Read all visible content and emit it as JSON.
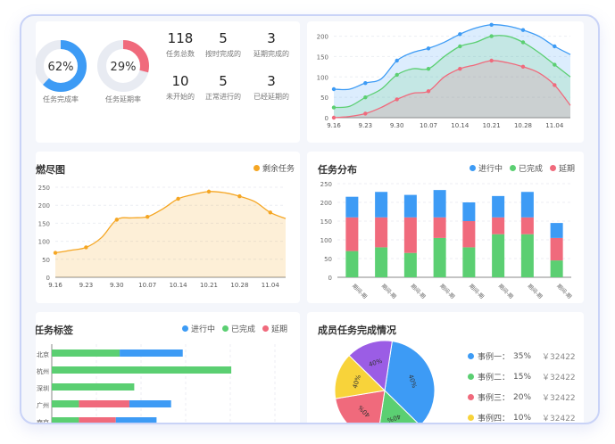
{
  "colors": {
    "blue": "#3d9bf5",
    "green": "#5bcf72",
    "red": "#f06a7c",
    "orange": "#f5a623",
    "purple": "#9b5de5",
    "yellow": "#f8d33a"
  },
  "overview": {
    "donuts": [
      {
        "value": "62%",
        "label": "任务完成率",
        "fraction": 0.62,
        "color": "#3d9bf5"
      },
      {
        "value": "29%",
        "label": "任务延期率",
        "fraction": 0.29,
        "color": "#f06a7c"
      }
    ],
    "stats": [
      {
        "num": "118",
        "label": "任务总数"
      },
      {
        "num": "5",
        "label": "按时完成的"
      },
      {
        "num": "3",
        "label": "延期完成的"
      },
      {
        "num": "10",
        "label": "未开始的"
      },
      {
        "num": "5",
        "label": "正常进行的"
      },
      {
        "num": "3",
        "label": "已经延期的"
      }
    ]
  },
  "burndown": {
    "title": "燃尽图",
    "legend": "剩余任务"
  },
  "distribution": {
    "title": "任务分布",
    "legend": [
      "进行中",
      "已完成",
      "延期"
    ]
  },
  "tags": {
    "title": "任务标签",
    "legend": [
      "进行中",
      "已完成",
      "延期"
    ]
  },
  "members": {
    "title": "成员任务完成情况",
    "legend": [
      {
        "name": "事例一：",
        "pct": "35%",
        "amount": "￥32422",
        "color": "#3d9bf5"
      },
      {
        "name": "事例二：",
        "pct": "15%",
        "amount": "￥32422",
        "color": "#5bcf72"
      },
      {
        "name": "事例三：",
        "pct": "20%",
        "amount": "￥32422",
        "color": "#f06a7c"
      },
      {
        "name": "事例四：",
        "pct": "10%",
        "amount": "￥32422",
        "color": "#f8d33a"
      }
    ]
  },
  "chart_data": [
    {
      "type": "area",
      "x": [
        "9.16",
        "9.20",
        "9.23",
        "9.27",
        "9.30",
        "10.03",
        "10.07",
        "10.10",
        "10.14",
        "10.17",
        "10.21",
        "10.24",
        "10.28",
        "10.31",
        "11.04",
        "11.07"
      ],
      "xticks": [
        "9.16",
        "9.23",
        "9.30",
        "10.07",
        "10.14",
        "10.21",
        "10.28",
        "11.04"
      ],
      "yticks": [
        0,
        50,
        100,
        150,
        200
      ],
      "ylim": [
        0,
        210
      ],
      "series": [
        {
          "color": "#3d9bf5",
          "values": [
            70,
            70,
            85,
            95,
            140,
            160,
            170,
            185,
            205,
            220,
            228,
            225,
            215,
            200,
            175,
            155
          ]
        },
        {
          "color": "#5bcf72",
          "values": [
            25,
            28,
            50,
            70,
            105,
            120,
            120,
            150,
            175,
            185,
            200,
            200,
            185,
            160,
            130,
            100
          ]
        },
        {
          "color": "#f06a7c",
          "values": [
            0,
            3,
            10,
            25,
            45,
            60,
            65,
            100,
            120,
            130,
            140,
            135,
            125,
            110,
            80,
            30
          ]
        }
      ]
    },
    {
      "type": "area",
      "title": "燃尽图",
      "x": [
        "9.16",
        "9.20",
        "9.23",
        "9.27",
        "9.30",
        "10.03",
        "10.07",
        "10.10",
        "10.14",
        "10.17",
        "10.21",
        "10.24",
        "10.28",
        "10.31",
        "11.04",
        "11.07"
      ],
      "xticks": [
        "9.16",
        "9.23",
        "9.30",
        "10.07",
        "10.14",
        "10.21",
        "10.28",
        "11.04"
      ],
      "yticks": [
        0,
        50,
        100,
        150,
        200,
        250
      ],
      "ylim": [
        0,
        260
      ],
      "series": [
        {
          "name": "剩余任务",
          "color": "#f5a623",
          "values": [
            68,
            75,
            83,
            110,
            160,
            165,
            168,
            190,
            218,
            230,
            238,
            235,
            225,
            210,
            180,
            163
          ]
        }
      ]
    },
    {
      "type": "bar",
      "title": "任务分布",
      "categories": [
        "期间-期",
        "期间-期",
        "期间-期",
        "期间-期",
        "期间-期",
        "期间-期",
        "期间-期",
        "期间-期"
      ],
      "yticks": [
        0,
        50,
        100,
        150,
        200,
        250
      ],
      "ylim": [
        0,
        250
      ],
      "series": [
        {
          "name": "已完成",
          "color": "#5bcf72",
          "values": [
            70,
            80,
            65,
            105,
            80,
            115,
            115,
            45
          ]
        },
        {
          "name": "延期",
          "color": "#f06a7c",
          "values": [
            90,
            80,
            95,
            55,
            70,
            45,
            45,
            60
          ]
        },
        {
          "name": "进行中",
          "color": "#3d9bf5",
          "values": [
            55,
            68,
            60,
            73,
            50,
            57,
            68,
            40
          ]
        }
      ]
    },
    {
      "type": "bar",
      "title": "任务标签",
      "categories": [
        "北京",
        "杭州",
        "深圳",
        "广州",
        "南京"
      ],
      "series": [
        {
          "name": "已完成",
          "color": "#5bcf72",
          "values": [
            70,
            185,
            85,
            28,
            28
          ]
        },
        {
          "name": "延期",
          "color": "#f06a7c",
          "values": [
            0,
            0,
            0,
            52,
            38
          ]
        },
        {
          "name": "进行中",
          "color": "#3d9bf5",
          "values": [
            65,
            0,
            0,
            43,
            42
          ]
        }
      ]
    },
    {
      "type": "pie",
      "title": "成员任务完成情况",
      "slices": [
        {
          "value": 35,
          "label": "40%",
          "color": "#3d9bf5"
        },
        {
          "value": 15,
          "label": "40%",
          "color": "#5bcf72"
        },
        {
          "value": 20,
          "label": "40%",
          "color": "#f06a7c"
        },
        {
          "value": 15,
          "label": "40%",
          "color": "#f8d33a"
        },
        {
          "value": 15,
          "label": "40%",
          "color": "#9b5de5"
        }
      ]
    }
  ]
}
